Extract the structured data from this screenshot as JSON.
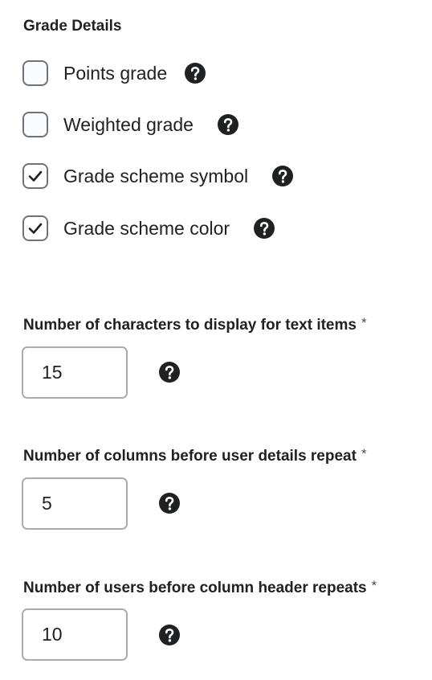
{
  "grade_details": {
    "title": "Grade Details",
    "options": [
      {
        "label": "Points grade",
        "checked": false,
        "icon": "help-icon"
      },
      {
        "label": "Weighted grade",
        "checked": false,
        "icon": "help-icon"
      },
      {
        "label": "Grade scheme symbol",
        "checked": true,
        "icon": "help-icon"
      },
      {
        "label": "Grade scheme color",
        "checked": true,
        "icon": "help-icon"
      }
    ]
  },
  "fields": [
    {
      "label": "Number of characters to display for text items",
      "required_marker": "*",
      "value": "15"
    },
    {
      "label": "Number of columns before user details repeat",
      "required_marker": "*",
      "value": "5"
    },
    {
      "label": "Number of users before column header repeats",
      "required_marker": "*",
      "value": "10"
    }
  ],
  "colors": {
    "text": "#202122",
    "checkbox_border": "#6e7376",
    "input_border": "#a9acae",
    "help_icon": "#202122"
  }
}
